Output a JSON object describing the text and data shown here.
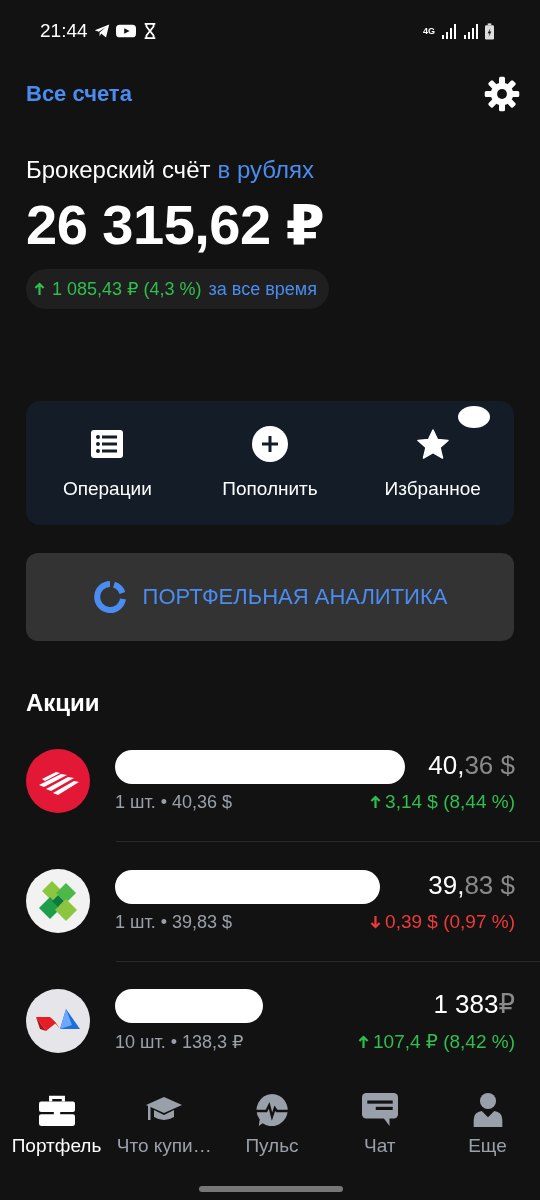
{
  "status_bar": {
    "time": "21:44",
    "network": "4G"
  },
  "header": {
    "accounts_link": "Все счета"
  },
  "account": {
    "title": "Брокерский счёт",
    "currency_link": "в рублях",
    "balance": "26 315,62 ₽",
    "change": {
      "kind": "gain",
      "amount": "1 085,43 ₽ (4,3 %)",
      "period": "за все время"
    }
  },
  "actions": [
    {
      "kind": "list",
      "label": "Операции",
      "redacted_badge": false
    },
    {
      "kind": "plus",
      "label": "Пополнить",
      "redacted_badge": false
    },
    {
      "kind": "star",
      "label": "Избранное",
      "redacted_badge": true
    }
  ],
  "analytics_button": {
    "label": "ПОРТФЕЛЬНАЯ АНАЛИТИКА"
  },
  "section_title": "Акции",
  "stocks": [
    {
      "name_redacted": true,
      "quantity": "1 шт. • 40,36 $",
      "price_main": "40,",
      "price_rest": "36 $",
      "kind": "gain",
      "change": "3,14 $ (8,44 %)"
    },
    {
      "name_redacted": true,
      "quantity": "1 шт. • 39,83 $",
      "price_main": "39,",
      "price_rest": "83 $",
      "kind": "loss",
      "change": "0,39 $ (0,97 %)"
    },
    {
      "name_redacted": true,
      "quantity": "10 шт. • 138,3 ₽",
      "price_main": "1 383",
      "price_rest": "₽",
      "kind": "gain",
      "change": "107,4 ₽ (8,42 %)"
    }
  ],
  "bottom_nav": [
    {
      "label": "Портфель",
      "selected": true
    },
    {
      "label": "Что купи…",
      "selected": false
    },
    {
      "label": "Пульс",
      "selected": false
    },
    {
      "label": "Чат",
      "selected": false
    },
    {
      "label": "Еще",
      "selected": false
    }
  ]
}
